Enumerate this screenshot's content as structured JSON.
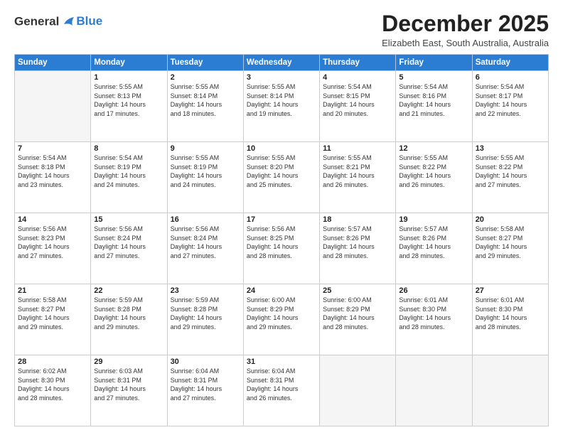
{
  "header": {
    "logo_general": "General",
    "logo_blue": "Blue",
    "month_title": "December 2025",
    "location": "Elizabeth East, South Australia, Australia"
  },
  "days_of_week": [
    "Sunday",
    "Monday",
    "Tuesday",
    "Wednesday",
    "Thursday",
    "Friday",
    "Saturday"
  ],
  "weeks": [
    [
      {
        "day": "",
        "info": ""
      },
      {
        "day": "1",
        "info": "Sunrise: 5:55 AM\nSunset: 8:13 PM\nDaylight: 14 hours\nand 17 minutes."
      },
      {
        "day": "2",
        "info": "Sunrise: 5:55 AM\nSunset: 8:14 PM\nDaylight: 14 hours\nand 18 minutes."
      },
      {
        "day": "3",
        "info": "Sunrise: 5:55 AM\nSunset: 8:14 PM\nDaylight: 14 hours\nand 19 minutes."
      },
      {
        "day": "4",
        "info": "Sunrise: 5:54 AM\nSunset: 8:15 PM\nDaylight: 14 hours\nand 20 minutes."
      },
      {
        "day": "5",
        "info": "Sunrise: 5:54 AM\nSunset: 8:16 PM\nDaylight: 14 hours\nand 21 minutes."
      },
      {
        "day": "6",
        "info": "Sunrise: 5:54 AM\nSunset: 8:17 PM\nDaylight: 14 hours\nand 22 minutes."
      }
    ],
    [
      {
        "day": "7",
        "info": "Sunrise: 5:54 AM\nSunset: 8:18 PM\nDaylight: 14 hours\nand 23 minutes."
      },
      {
        "day": "8",
        "info": "Sunrise: 5:54 AM\nSunset: 8:19 PM\nDaylight: 14 hours\nand 24 minutes."
      },
      {
        "day": "9",
        "info": "Sunrise: 5:55 AM\nSunset: 8:19 PM\nDaylight: 14 hours\nand 24 minutes."
      },
      {
        "day": "10",
        "info": "Sunrise: 5:55 AM\nSunset: 8:20 PM\nDaylight: 14 hours\nand 25 minutes."
      },
      {
        "day": "11",
        "info": "Sunrise: 5:55 AM\nSunset: 8:21 PM\nDaylight: 14 hours\nand 26 minutes."
      },
      {
        "day": "12",
        "info": "Sunrise: 5:55 AM\nSunset: 8:22 PM\nDaylight: 14 hours\nand 26 minutes."
      },
      {
        "day": "13",
        "info": "Sunrise: 5:55 AM\nSunset: 8:22 PM\nDaylight: 14 hours\nand 27 minutes."
      }
    ],
    [
      {
        "day": "14",
        "info": "Sunrise: 5:56 AM\nSunset: 8:23 PM\nDaylight: 14 hours\nand 27 minutes."
      },
      {
        "day": "15",
        "info": "Sunrise: 5:56 AM\nSunset: 8:24 PM\nDaylight: 14 hours\nand 27 minutes."
      },
      {
        "day": "16",
        "info": "Sunrise: 5:56 AM\nSunset: 8:24 PM\nDaylight: 14 hours\nand 27 minutes."
      },
      {
        "day": "17",
        "info": "Sunrise: 5:56 AM\nSunset: 8:25 PM\nDaylight: 14 hours\nand 28 minutes."
      },
      {
        "day": "18",
        "info": "Sunrise: 5:57 AM\nSunset: 8:26 PM\nDaylight: 14 hours\nand 28 minutes."
      },
      {
        "day": "19",
        "info": "Sunrise: 5:57 AM\nSunset: 8:26 PM\nDaylight: 14 hours\nand 28 minutes."
      },
      {
        "day": "20",
        "info": "Sunrise: 5:58 AM\nSunset: 8:27 PM\nDaylight: 14 hours\nand 29 minutes."
      }
    ],
    [
      {
        "day": "21",
        "info": "Sunrise: 5:58 AM\nSunset: 8:27 PM\nDaylight: 14 hours\nand 29 minutes."
      },
      {
        "day": "22",
        "info": "Sunrise: 5:59 AM\nSunset: 8:28 PM\nDaylight: 14 hours\nand 29 minutes."
      },
      {
        "day": "23",
        "info": "Sunrise: 5:59 AM\nSunset: 8:28 PM\nDaylight: 14 hours\nand 29 minutes."
      },
      {
        "day": "24",
        "info": "Sunrise: 6:00 AM\nSunset: 8:29 PM\nDaylight: 14 hours\nand 29 minutes."
      },
      {
        "day": "25",
        "info": "Sunrise: 6:00 AM\nSunset: 8:29 PM\nDaylight: 14 hours\nand 28 minutes."
      },
      {
        "day": "26",
        "info": "Sunrise: 6:01 AM\nSunset: 8:30 PM\nDaylight: 14 hours\nand 28 minutes."
      },
      {
        "day": "27",
        "info": "Sunrise: 6:01 AM\nSunset: 8:30 PM\nDaylight: 14 hours\nand 28 minutes."
      }
    ],
    [
      {
        "day": "28",
        "info": "Sunrise: 6:02 AM\nSunset: 8:30 PM\nDaylight: 14 hours\nand 28 minutes."
      },
      {
        "day": "29",
        "info": "Sunrise: 6:03 AM\nSunset: 8:31 PM\nDaylight: 14 hours\nand 27 minutes."
      },
      {
        "day": "30",
        "info": "Sunrise: 6:04 AM\nSunset: 8:31 PM\nDaylight: 14 hours\nand 27 minutes."
      },
      {
        "day": "31",
        "info": "Sunrise: 6:04 AM\nSunset: 8:31 PM\nDaylight: 14 hours\nand 26 minutes."
      },
      {
        "day": "",
        "info": ""
      },
      {
        "day": "",
        "info": ""
      },
      {
        "day": "",
        "info": ""
      }
    ]
  ]
}
